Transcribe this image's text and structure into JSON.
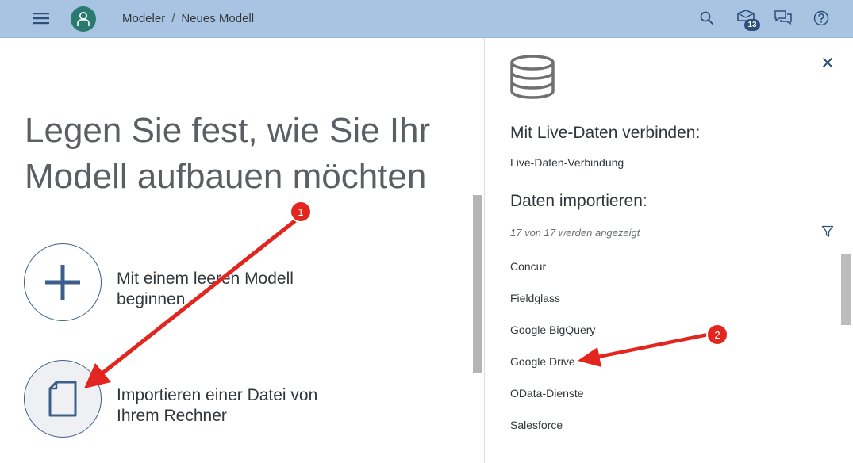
{
  "shellbar": {
    "breadcrumb": [
      "Modeler",
      "/",
      "Neues Modell"
    ],
    "notification_count": "13",
    "icons": [
      "menu-icon",
      "user-icon",
      "search-icon",
      "notification-icon",
      "feedback-icon",
      "help-icon"
    ]
  },
  "left": {
    "title": "Legen Sie fest, wie Sie Ihr Modell aufbauen möchten",
    "options": [
      {
        "label": "Mit einem leeren Modell beginnen",
        "icon": "plus-icon"
      },
      {
        "label": "Importieren einer Datei von Ihrem Rechner",
        "icon": "document-icon"
      }
    ]
  },
  "right": {
    "live_title": "Mit Live-Daten verbinden:",
    "live_link": "Live-Daten-Verbindung",
    "import_title": "Daten importieren:",
    "count_text": "17 von 17 werden angezeigt",
    "sources": [
      "Concur",
      "Fieldglass",
      "Google BigQuery",
      "Google Drive",
      "OData-Dienste",
      "Salesforce"
    ],
    "icons": [
      "database-icon",
      "close-icon",
      "filter-icon"
    ]
  },
  "annotations": {
    "markers": [
      "1",
      "2"
    ],
    "color": "#e3251f"
  },
  "colors": {
    "shellbar": "#a9c4e2",
    "accent": "#3b5f8a",
    "avatar": "#2a7a70",
    "badge": "#2b4f7a"
  }
}
